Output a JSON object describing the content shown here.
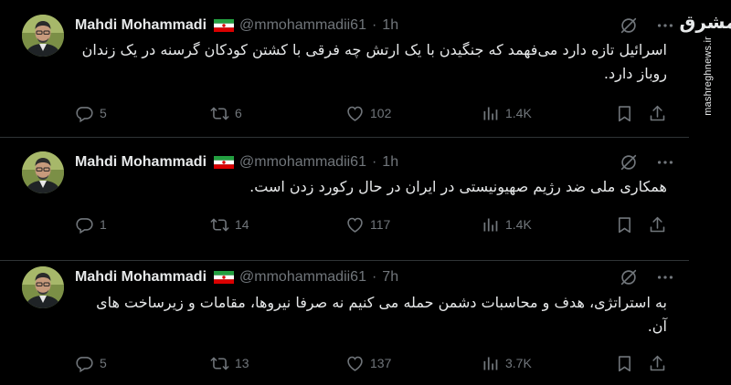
{
  "watermark": {
    "logo": "مشرق",
    "url": "mashreghnews.ir"
  },
  "tweets": [
    {
      "author": "Mahdi Mohammadi",
      "handle": "@mmohammadii61",
      "separator": "·",
      "time": "1h",
      "text": "اسرائیل تازه دارد می‌فهمد که جنگیدن با یک ارتش چه فرقی با کشتن کودکان گرسنه در یک زندان روباز دارد.",
      "replies": "5",
      "reposts": "6",
      "likes": "102",
      "views": "1.4K"
    },
    {
      "author": "Mahdi Mohammadi",
      "handle": "@mmohammadii61",
      "separator": "·",
      "time": "1h",
      "text": "همکاری ملی ضد رژیم صهیونیستی در ایران در حال رکورد زدن است.",
      "replies": "1",
      "reposts": "14",
      "likes": "117",
      "views": "1.4K"
    },
    {
      "author": "Mahdi Mohammadi",
      "handle": "@mmohammadii61",
      "separator": "·",
      "time": "7h",
      "text": "به استراتژی، هدف و محاسبات دشمن حمله می کنیم نه صرفا نیروها، مقامات و زیرساخت های آن.",
      "replies": "5",
      "reposts": "13",
      "likes": "137",
      "views": "3.7K"
    }
  ]
}
